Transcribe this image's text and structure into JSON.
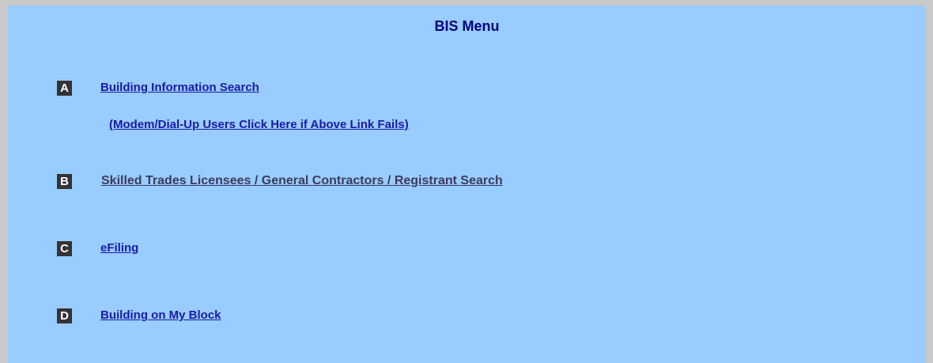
{
  "menu": {
    "title": "BIS Menu",
    "items": [
      {
        "letter": "A",
        "label": "Building Information Search",
        "sub_label": "(Modem/Dial-Up Users Click Here if Above Link Fails)"
      },
      {
        "letter": "B",
        "label": "Skilled Trades Licensees / General Contractors / Registrant Search"
      },
      {
        "letter": "C",
        "label": "eFiling"
      },
      {
        "letter": "D",
        "label": "Building on My Block"
      }
    ]
  },
  "colors": {
    "panel_bg": "#99ccff",
    "frame": "#c9c9c9",
    "title": "#000080",
    "link": "#1a1aa6",
    "badge_bg": "#333333"
  }
}
